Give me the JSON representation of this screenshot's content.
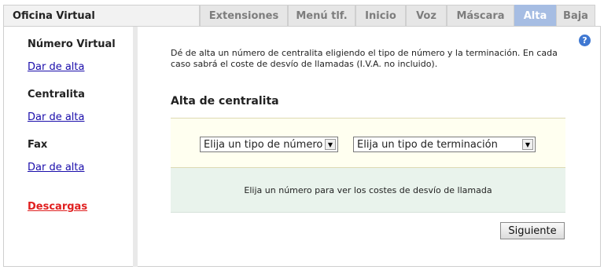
{
  "app": {
    "title": "Oficina Virtual"
  },
  "tabs": [
    {
      "label": "Extensiones",
      "active": false
    },
    {
      "label": "Menú tlf.",
      "active": false
    },
    {
      "label": "Inicio",
      "active": false
    },
    {
      "label": "Voz",
      "active": false
    },
    {
      "label": "Máscara",
      "active": false
    },
    {
      "label": "Alta",
      "active": true
    },
    {
      "label": "Baja",
      "active": false
    }
  ],
  "sidebar": {
    "sections": [
      {
        "heading": "Número Virtual",
        "link": "Dar de alta"
      },
      {
        "heading": "Centralita",
        "link": "Dar de alta"
      },
      {
        "heading": "Fax",
        "link": "Dar de alta"
      }
    ],
    "downloads": "Descargas"
  },
  "main": {
    "help_icon": "question-icon",
    "intro": "Dé de alta un número de centralita eligiendo el tipo de número y la terminación. En cada caso sabrá el coste de desvío de llamadas (I.V.A. no incluido).",
    "section_title": "Alta de centralita",
    "select_number_type": "Elija un tipo de número",
    "select_termination_type": "Elija un tipo de terminación",
    "cost_message": "Elija un número para ver los costes de desvío de llamada",
    "next_button": "Siguiente"
  },
  "colors": {
    "active_tab": "#a6bde3",
    "link": "#1a0dab",
    "downloads_link": "#e02020",
    "select_band": "#fffff0",
    "cost_band": "#e9f3ec"
  }
}
